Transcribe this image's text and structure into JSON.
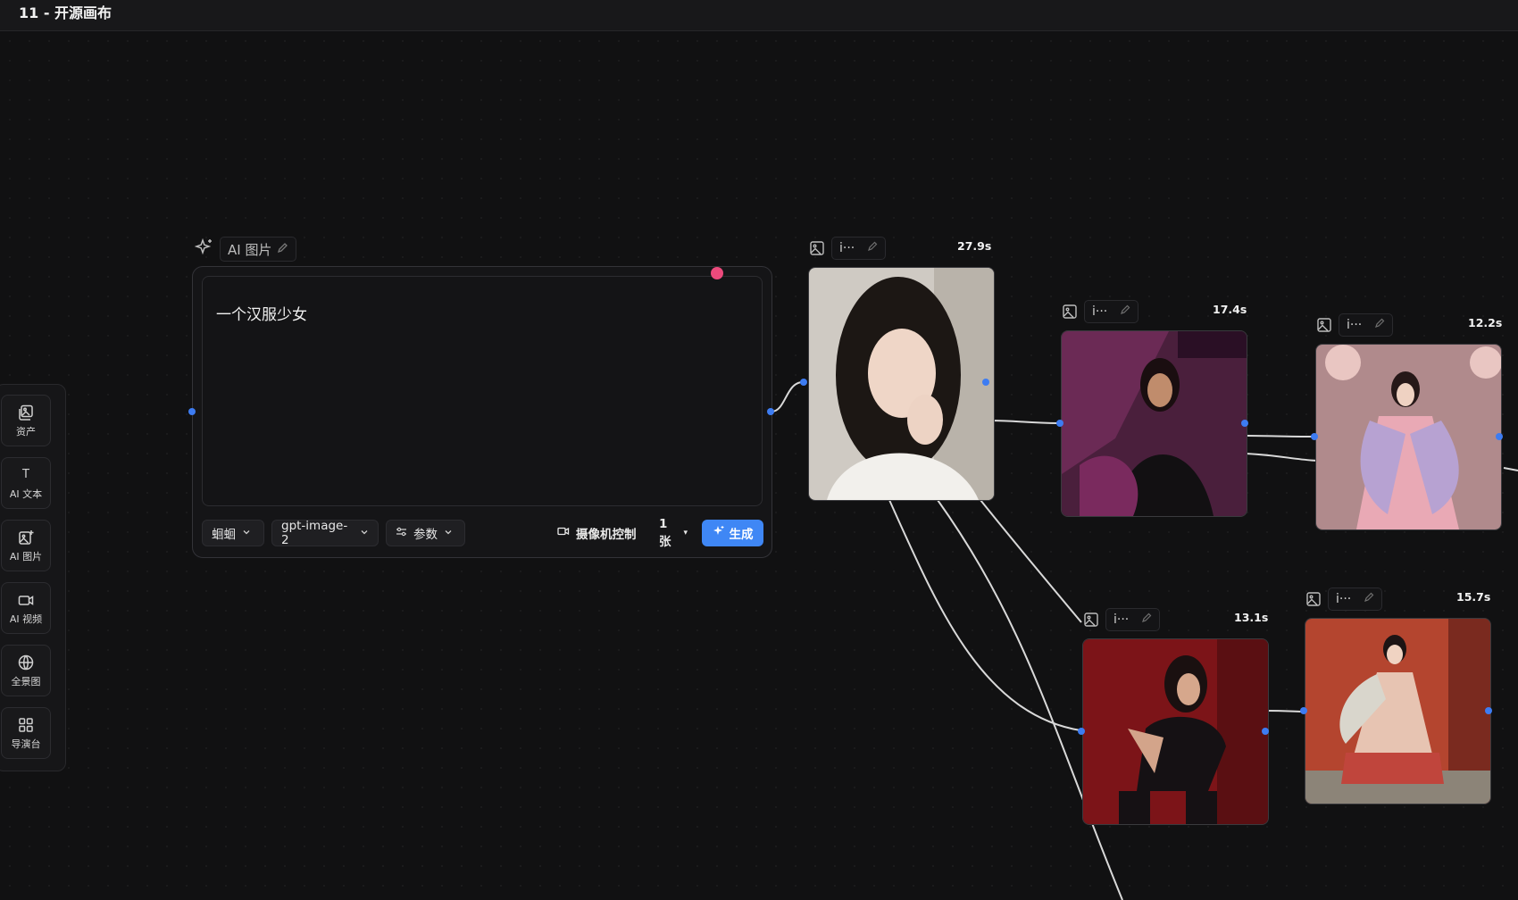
{
  "app": {
    "title": "11 - 开源画布"
  },
  "toolbar": {
    "items": [
      {
        "label": "资产",
        "icon": "assets-icon"
      },
      {
        "label": "AI 文本",
        "icon": "text-icon"
      },
      {
        "label": "AI 图片",
        "icon": "image-add-icon"
      },
      {
        "label": "AI 视频",
        "icon": "video-icon"
      },
      {
        "label": "全景图",
        "icon": "panorama-icon"
      },
      {
        "label": "导演台",
        "icon": "grid-icon"
      }
    ]
  },
  "prompt_node": {
    "header": "AI 图片",
    "prompt": "一个汉服少女",
    "style_select": "蛔蛔",
    "model_select": "gpt-image-2",
    "params_label": "参数",
    "camera_label": "摄像机控制",
    "count_select": "1张",
    "generate_label": "生成"
  },
  "image_nodes": [
    {
      "name": "i···",
      "time": "27.9s",
      "image": "portrait girl in white sweater"
    },
    {
      "name": "i···",
      "time": "17.4s",
      "image": "woman in black dress neon room"
    },
    {
      "name": "i···",
      "time": "12.2s",
      "image": "hanfu girl pink lanterns"
    },
    {
      "name": "i···",
      "time": "13.1s",
      "image": "woman in leather red background"
    },
    {
      "name": "i···",
      "time": "15.7s",
      "image": "hanfu girl red wall"
    }
  ],
  "colors": {
    "accent": "#3f87f5",
    "port": "#3d7cf2",
    "handle": "#ec4a7c"
  }
}
